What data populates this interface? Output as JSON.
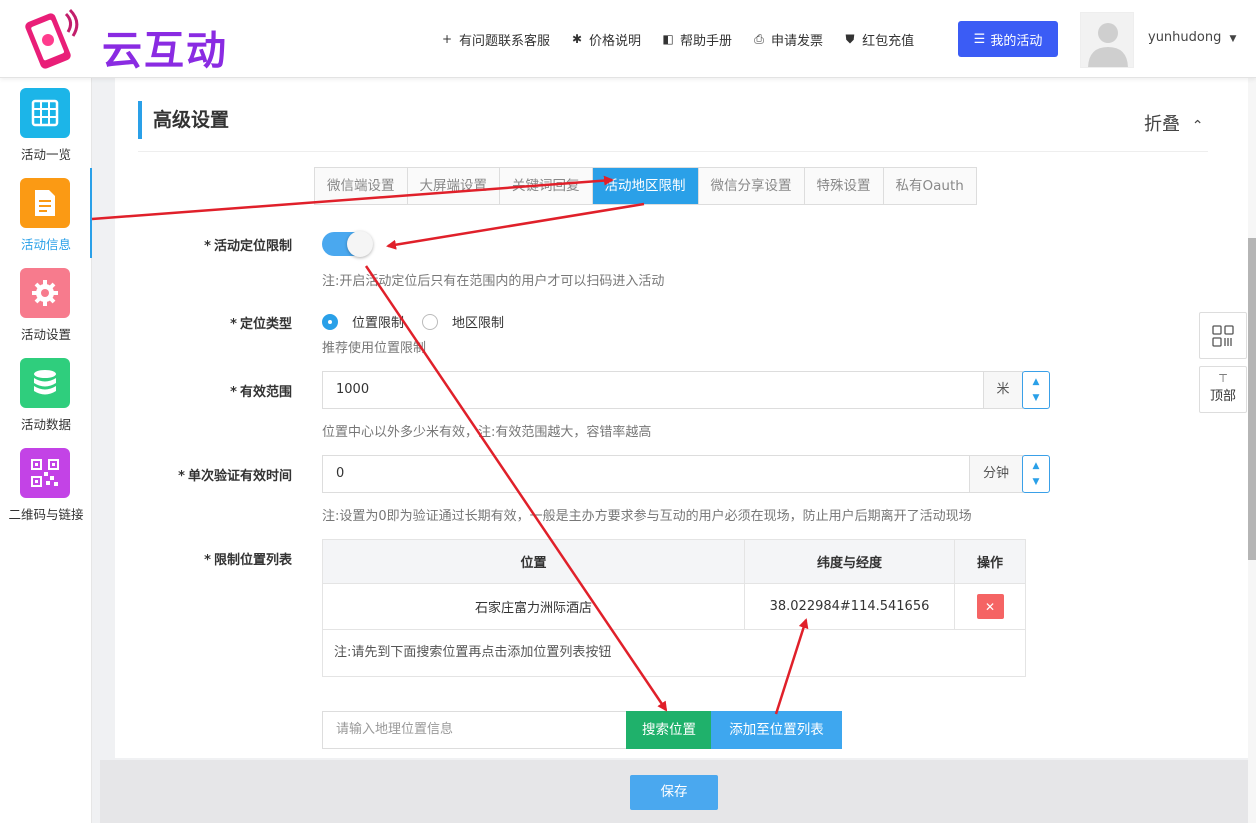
{
  "header": {
    "logo_text": "云互动",
    "nav": [
      {
        "icon": "user-plus-icon",
        "glyph": "+",
        "label": "有问题联系客服"
      },
      {
        "icon": "gear-icon",
        "glyph": "✱",
        "label": "价格说明"
      },
      {
        "icon": "book-icon",
        "glyph": "◧",
        "label": "帮助手册"
      },
      {
        "icon": "printer-icon",
        "glyph": "⎙",
        "label": "申请发票"
      },
      {
        "icon": "shield-icon",
        "glyph": "⛊",
        "label": "红包充值"
      }
    ],
    "my_activity_label": "我的活动",
    "username": "yunhudong"
  },
  "sidebar": {
    "items": [
      {
        "label": "活动一览",
        "icon": "grid-icon",
        "color": "#1cb5e8",
        "active": false
      },
      {
        "label": "活动信息",
        "icon": "document-icon",
        "color": "#fb9a14",
        "active": true
      },
      {
        "label": "活动设置",
        "icon": "gear-icon",
        "color": "#f77b8d",
        "active": false
      },
      {
        "label": "活动数据",
        "icon": "database-icon",
        "color": "#2fce7d",
        "active": false
      },
      {
        "label": "二维码与链接",
        "icon": "qrcode-icon",
        "color": "#c343e6",
        "active": false
      }
    ]
  },
  "section": {
    "title": "高级设置",
    "collapse_label": "折叠",
    "tabs": [
      "微信端设置",
      "大屏端设置",
      "关键词回复",
      "活动地区限制",
      "微信分享设置",
      "特殊设置",
      "私有Oauth"
    ],
    "active_tab_index": 3
  },
  "form": {
    "location_limit": {
      "label": "活动定位限制",
      "enabled": true,
      "note": "注:开启活动定位后只有在范围内的用户才可以扫码进入活动"
    },
    "location_type": {
      "label": "定位类型",
      "options": [
        "位置限制",
        "地区限制"
      ],
      "selected": "位置限制",
      "note": "推荐使用位置限制"
    },
    "range": {
      "label": "有效范围",
      "value": "1000",
      "unit": "米",
      "note": "位置中心以外多少米有效，注:有效范围越大，容错率越高"
    },
    "verify_time": {
      "label": "单次验证有效时间",
      "value": "0",
      "unit": "分钟",
      "note": "注:设置为0即为验证通过长期有效，一般是主办方要求参与互动的用户必须在现场，防止用户后期离开了活动现场"
    },
    "location_list": {
      "label": "限制位置列表",
      "columns": [
        "位置",
        "纬度与经度",
        "操作"
      ],
      "rows": [
        {
          "location": "石家庄富力洲际酒店",
          "coords": "38.022984#114.541656"
        }
      ],
      "note": "注:请先到下面搜索位置再点击添加位置列表按钮"
    },
    "search": {
      "placeholder": "请输入地理位置信息",
      "search_button": "搜索位置",
      "add_button": "添加至位置列表"
    }
  },
  "required_mark": "*",
  "save_label": "保存",
  "float_top_label": "顶部",
  "colors": {
    "accent": "#2aa0e8",
    "primary_button": "#3b5cf5",
    "search_button": "#1fb16b",
    "delete_button": "#f56464",
    "annotation_arrow": "#e0202a"
  }
}
